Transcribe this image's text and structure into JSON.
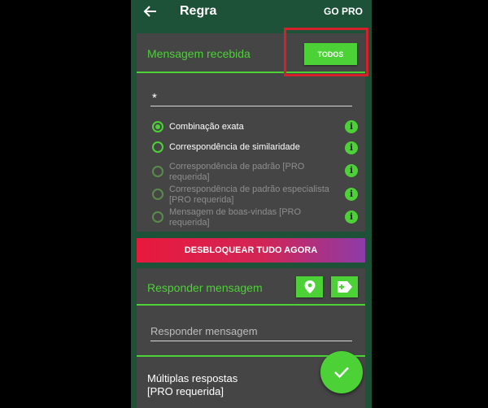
{
  "appbar": {
    "title": "Regra",
    "go_pro_label": "GO PRO"
  },
  "received": {
    "title": "Mensagem recebida",
    "todos_label": "TODOS",
    "input_value": "*",
    "options": [
      {
        "label": "Combinação exata",
        "selected": true,
        "enabled": true
      },
      {
        "label": "Correspondência de similaridade",
        "selected": false,
        "enabled": true
      },
      {
        "label": "Correspondência de padrão [PRO requerida]",
        "selected": false,
        "enabled": false
      },
      {
        "label": "Correspondência de padrão especialista [PRO requerida]",
        "selected": false,
        "enabled": false
      },
      {
        "label": "Mensagem de boas-vindas [PRO requerida]",
        "selected": false,
        "enabled": false
      }
    ],
    "info_glyph": "i"
  },
  "unlock_label": "DESBLOQUEAR TUDO AGORA",
  "reply": {
    "title": "Responder mensagem",
    "input_placeholder": "Responder mensagem",
    "multi_label_line1": "Múltiplas respostas",
    "multi_label_line2": "[PRO requerida]"
  },
  "icons": {
    "back": "arrow-left-icon",
    "location": "location-pin-icon",
    "tag": "tag-add-icon",
    "fab": "check-icon"
  },
  "colors": {
    "accent": "#4cd137",
    "header_bg": "#1d5238",
    "card_bg": "#454545",
    "highlight": "#d6202b"
  }
}
